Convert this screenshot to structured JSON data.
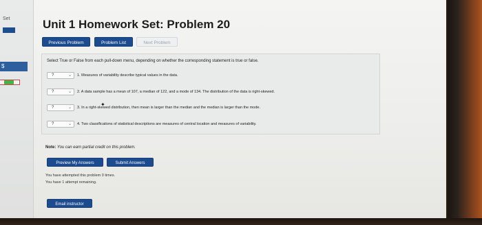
{
  "sidebar": {
    "label": "Set",
    "badge": "$"
  },
  "page": {
    "title": "Unit 1 Homework Set: Problem 20"
  },
  "nav": {
    "previous": "Previous Problem",
    "list": "Problem List",
    "next": "Next Problem"
  },
  "problem": {
    "instructions": "Select True or False from each pull-down menu, depending on whether the corresponding statement is true or false.",
    "items": [
      {
        "selected": "?",
        "text": "1. Measures of variability describe typical values in the data."
      },
      {
        "selected": "?",
        "text": "2. A data sample has a mean of 107, a median of 122, and a mode of 134. The distribution of the data is right-skewed."
      },
      {
        "selected": "?",
        "text": "3. In a right-skewed distribution, then mean is larger than the median and the median is larger than the mode."
      },
      {
        "selected": "?",
        "text": "4. Two classifications of statistical descriptions are measures of central location and measures of variability."
      }
    ]
  },
  "note": {
    "label": "Note:",
    "text": "You can earn partial credit on this problem."
  },
  "actions": {
    "preview": "Preview My Answers",
    "submit": "Submit Answers"
  },
  "status": {
    "attempted": "You have attempted this problem 0 times.",
    "remaining": "You have 1 attempt remaining."
  },
  "email": "Email instructor",
  "colors": {
    "primary": "#1d4b8f",
    "sidebar_active": "#2d5e9e",
    "progress_green": "#46b24a"
  }
}
